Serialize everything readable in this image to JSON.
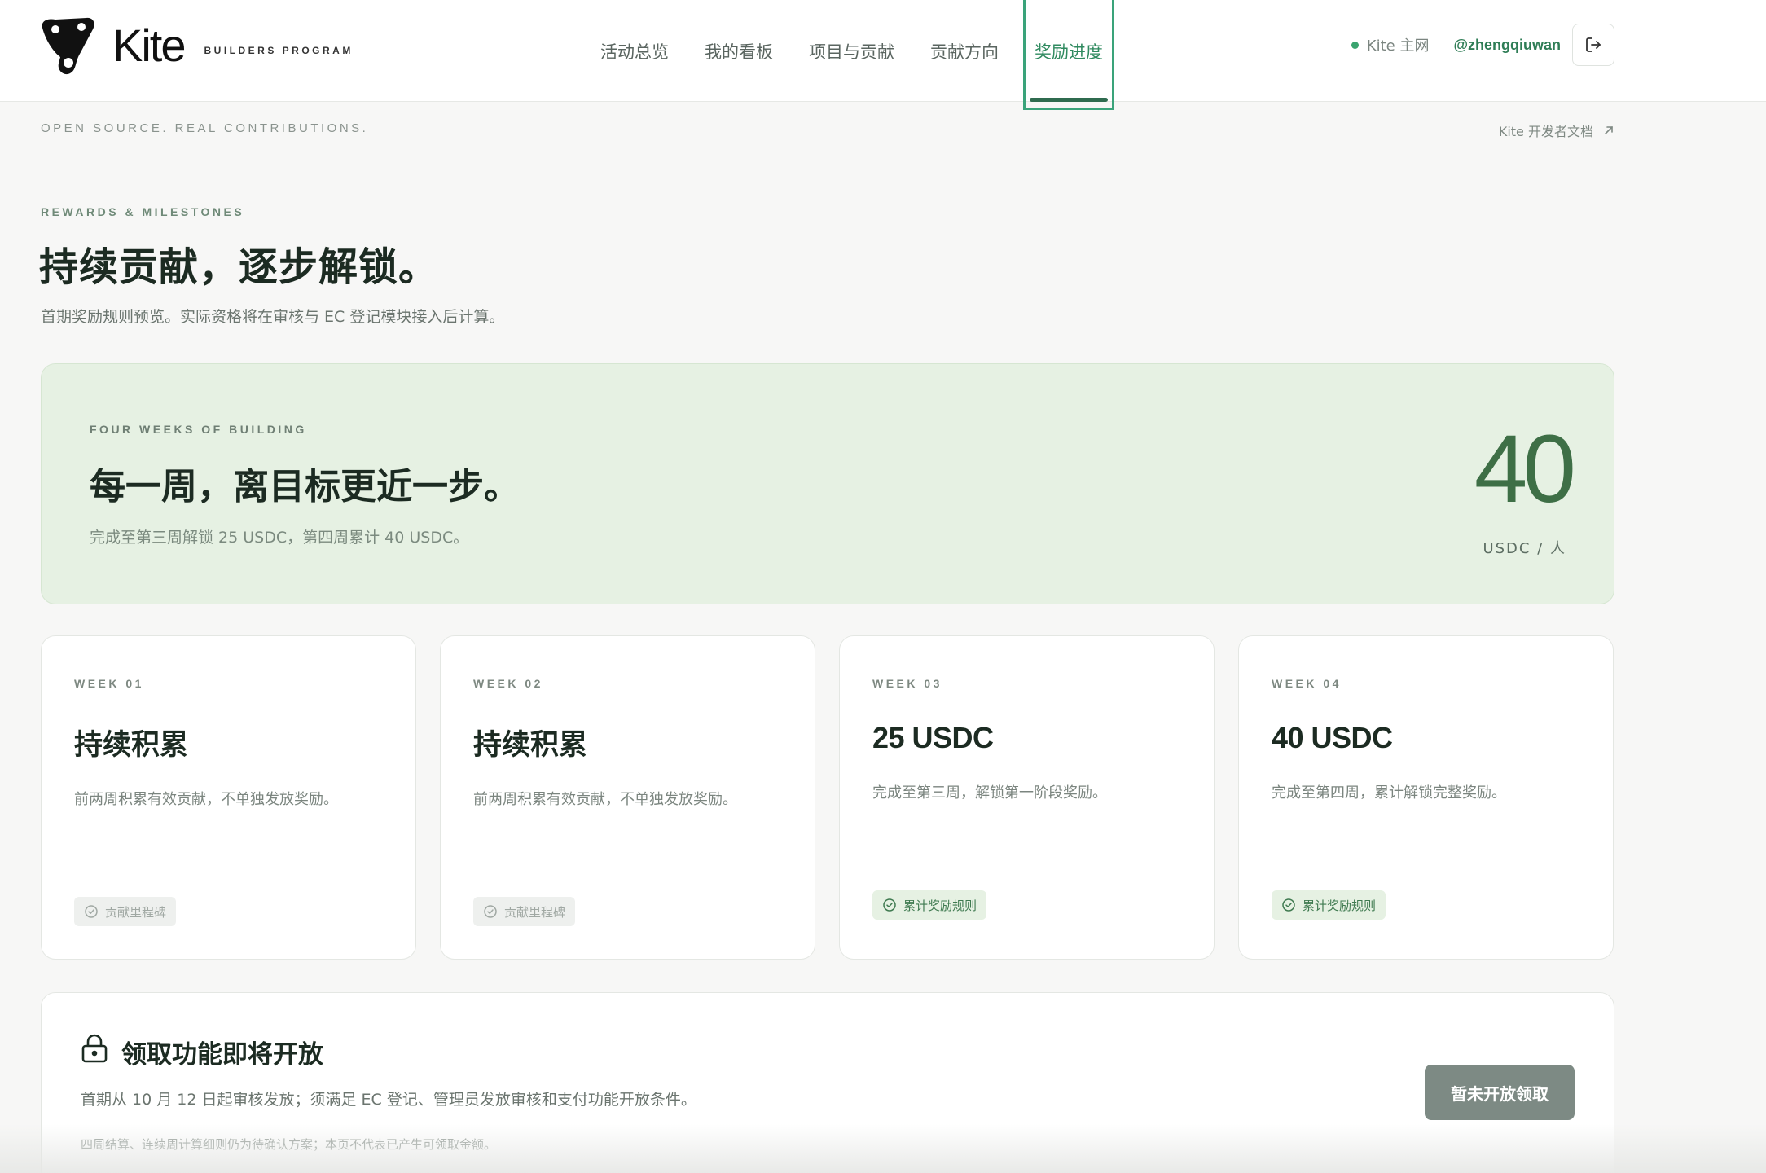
{
  "brand": {
    "name": "Kite",
    "subtitle": "BUILDERS PROGRAM"
  },
  "nav": {
    "items": [
      {
        "label": "活动总览"
      },
      {
        "label": "我的看板"
      },
      {
        "label": "项目与贡献"
      },
      {
        "label": "贡献方向"
      },
      {
        "label": "奖励进度"
      }
    ],
    "active": "奖励进度"
  },
  "header": {
    "network_label": "Kite 主网",
    "user_handle": "@zhengqiuwan"
  },
  "subheader": {
    "tagline": "OPEN SOURCE. REAL CONTRIBUTIONS.",
    "docs_link": "Kite 开发者文档"
  },
  "hero": {
    "eyebrow": "REWARDS & MILESTONES",
    "title": "持续贡献，逐步解锁。",
    "description": "首期奖励规则预览。实际资格将在审核与 EC 登记模块接入后计算。"
  },
  "banner": {
    "eyebrow": "FOUR WEEKS OF BUILDING",
    "title": "每一周，离目标更近一步。",
    "description": "完成至第三周解锁 25 USDC，第四周累计 40 USDC。",
    "amount": "40",
    "unit": "USDC / 人"
  },
  "weeks": [
    {
      "label": "WEEK 01",
      "title": "持续积累",
      "description": "前两周积累有效贡献，不单独发放奖励。",
      "badge": "贡献里程碑"
    },
    {
      "label": "WEEK 02",
      "title": "持续积累",
      "description": "前两周积累有效贡献，不单独发放奖励。",
      "badge": "贡献里程碑"
    },
    {
      "label": "WEEK 03",
      "title": "25 USDC",
      "description": "完成至第三周，解锁第一阶段奖励。",
      "badge": "累计奖励规则"
    },
    {
      "label": "WEEK 04",
      "title": "40 USDC",
      "description": "完成至第四周，累计解锁完整奖励。",
      "badge": "累计奖励规则"
    }
  ],
  "claim": {
    "title": "领取功能即将开放",
    "description": "首期从 10 月 12 日起审核发放；须满足 EC 登记、管理员发放审核和支付功能开放条件。",
    "note": "四周结算、连续周计算细则仍为待确认方案；本页不代表已产生可领取金额。",
    "button_label": "暂未开放领取"
  },
  "colors": {
    "accent": "#2f8a5f",
    "banner_bg": "#e6f1e3",
    "banner_number": "#3e6f46",
    "button_disabled": "#7d8a84"
  },
  "icons": {
    "logo": "kite-logo-icon",
    "network": "status-dot-icon",
    "logout": "logout-icon",
    "docs": "external-arrow-icon",
    "badge": "check-circle-icon",
    "claim": "lock-icon"
  }
}
